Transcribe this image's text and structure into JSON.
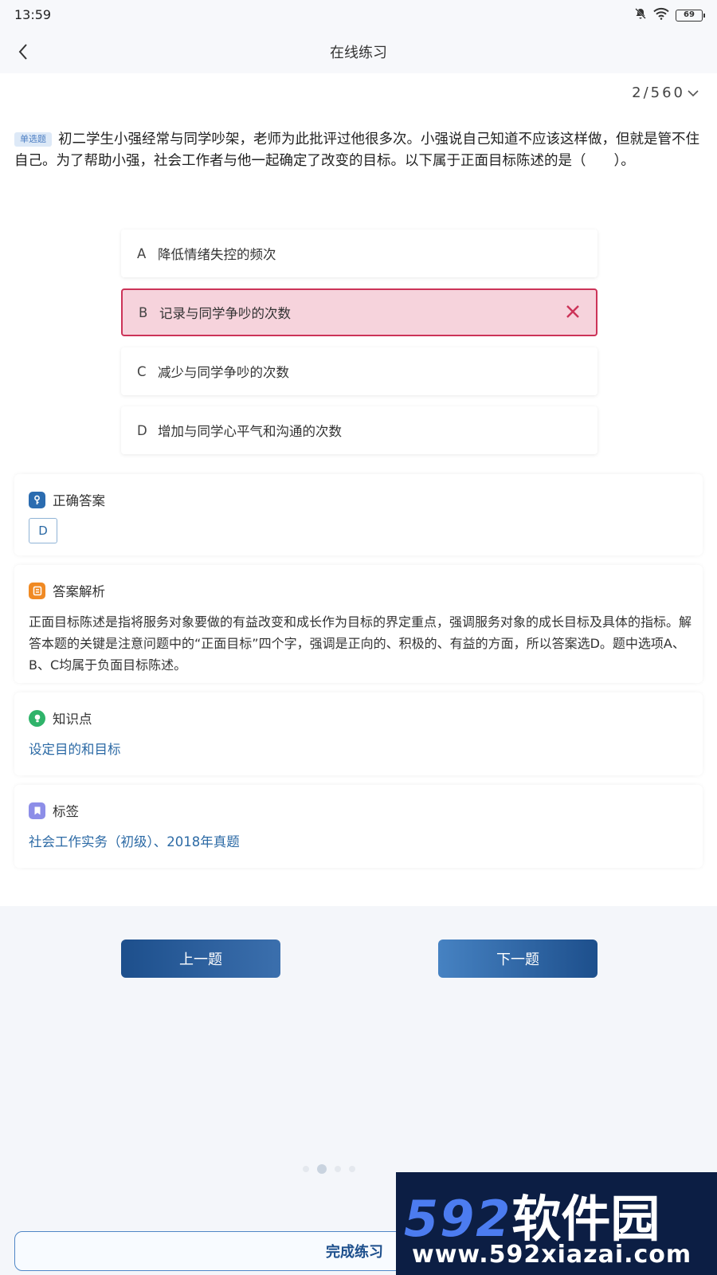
{
  "status_bar": {
    "time": "13:59",
    "battery": "69"
  },
  "nav": {
    "title": "在线练习"
  },
  "progress": {
    "text": "2/560"
  },
  "question": {
    "type": "单选题",
    "text": "初二学生小强经常与同学吵架，老师为此批评过他很多次。小强说自己知道不应该这样做，但就是管不住自己。为了帮助小强，社会工作者与他一起确定了改变的目标。以下属于正面目标陈述的是（　　）。"
  },
  "options": [
    {
      "letter": "A",
      "text": "降低情绪失控的频次"
    },
    {
      "letter": "B",
      "text": "记录与同学争吵的次数"
    },
    {
      "letter": "C",
      "text": "减少与同学争吵的次数"
    },
    {
      "letter": "D",
      "text": "增加与同学心平气和沟通的次数"
    }
  ],
  "correct": {
    "title": "正确答案",
    "value": "D"
  },
  "analysis": {
    "title": "答案解析",
    "text": "正面目标陈述是指将服务对象要做的有益改变和成长作为目标的界定重点，强调服务对象的成长目标及具体的指标。解答本题的关键是注意问题中的“正面目标”四个字，强调是正向的、积极的、有益的方面，所以答案选D。题中选项A、B、C均属于负面目标陈述。"
  },
  "knowledge": {
    "title": "知识点",
    "value": "设定目的和目标"
  },
  "tags": {
    "title": "标签",
    "value": "社会工作实务（初级）、2018年真题"
  },
  "buttons": {
    "prev": "上一题",
    "next": "下一题",
    "finish": "完成练习"
  },
  "watermark": {
    "logo_num": "592",
    "logo_cn": "软件园",
    "url": "www.592xiazai.com"
  },
  "colors": {
    "accent": "#1d4f8c",
    "wrong": "#cc3358",
    "link": "#2c6aa5"
  }
}
